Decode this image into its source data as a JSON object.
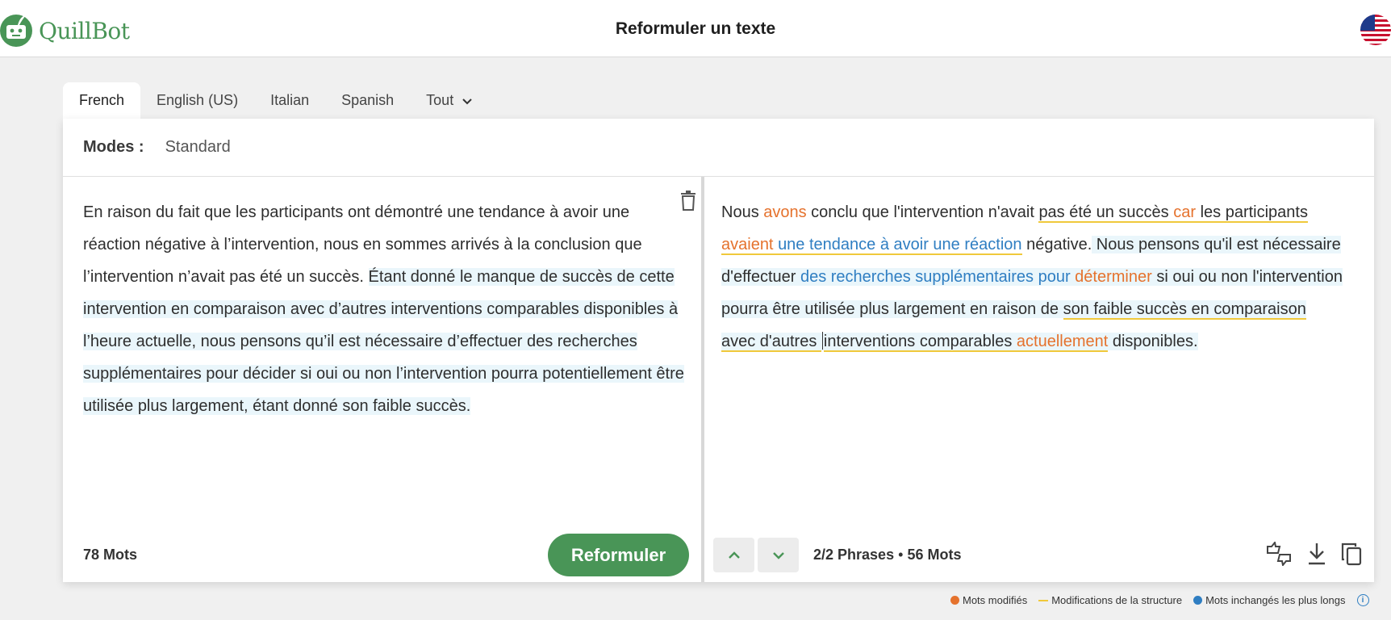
{
  "header": {
    "logo_text": "QuillBot",
    "title": "Reformuler un texte",
    "flag": "us-flag-icon"
  },
  "tabs": [
    {
      "label": "French",
      "active": true
    },
    {
      "label": "English (US)",
      "active": false
    },
    {
      "label": "Italian",
      "active": false
    },
    {
      "label": "Spanish",
      "active": false
    },
    {
      "label": "Tout",
      "active": false
    }
  ],
  "modes": {
    "label": "Modes :",
    "value": "Standard"
  },
  "input": {
    "plain": "En raison du fait que les participants ont démontré une tendance à avoir une réaction négative à l’intervention, nous en sommes arrivés à la conclusion que l’intervention n’avait pas été un succès. ",
    "highlighted": "Étant donné le manque de succès de cette intervention en comparaison avec d’autres interventions comparables disponibles à l’heure actuelle, nous pensons qu’il est nécessaire d’effectuer des recherches supplémentaires pour décider si oui ou non l’intervention pourra potentiellement être utilisée plus largement, étant donné son faible succès.",
    "word_count": "78 Mots"
  },
  "output": {
    "s1_p1": "Nous ",
    "s1_c1": "avons",
    "s1_p2": " conclu que l'intervention n'avait ",
    "s1_u1": "pas été un succès",
    "s1_p3": " ",
    "s1_c2": "car",
    "s1_p4": " ",
    "s1_u2": "les participants",
    "s1_p5": " ",
    "s1_c3": "avaient",
    "s1_p6": " ",
    "s1_k1": "une tendance à avoir une réaction",
    "s1_p7": " négative.",
    "s2_p1": " Nous pensons qu'il est nécessaire d'effectuer ",
    "s2_k1": "des recherches supplémentaires pour",
    "s2_p2": " ",
    "s2_c1": "déterminer",
    "s2_p3": " si oui ou non l'intervention pourra être utilisée plus largement en raison de ",
    "s2_u1a": "son faible succès en comparaison avec d'autres ",
    "s2_u1b": "interventions comparables ",
    "s2_c2": "actuellement",
    "s2_p4": " disponibles.",
    "sentences_bold": "2/2",
    "sentences_label": " Phrases",
    "separator": "•",
    "word_count": "56 Mots"
  },
  "actions": {
    "rephrase": "Reformuler"
  },
  "legend": {
    "changed": "Mots modifiés",
    "structure": "Modifications de la structure",
    "longest": "Mots inchangés les plus longs",
    "info": "i"
  },
  "colors": {
    "brand": "#499557",
    "changed": "#e5722d",
    "structure": "#f0c93b",
    "unchanged": "#2f7ec2",
    "highlight": "#eaf6fb"
  }
}
